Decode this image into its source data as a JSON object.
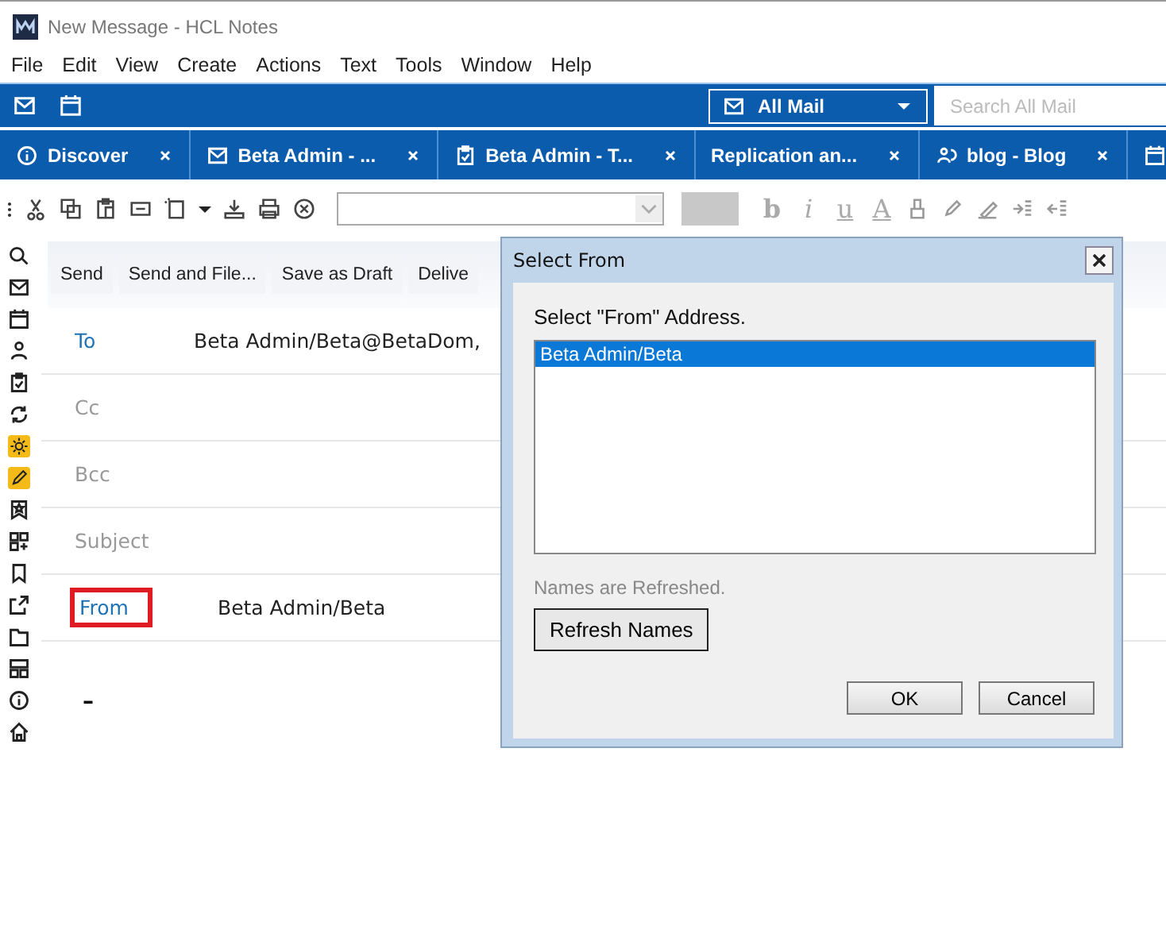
{
  "window": {
    "title": "New Message - HCL Notes"
  },
  "menu": [
    "File",
    "Edit",
    "View",
    "Create",
    "Actions",
    "Text",
    "Tools",
    "Window",
    "Help"
  ],
  "scope": {
    "label": "All Mail"
  },
  "search": {
    "placeholder": "Search All Mail"
  },
  "tabs": [
    {
      "label": "Discover"
    },
    {
      "label": "Beta Admin - ..."
    },
    {
      "label": "Beta Admin - T..."
    },
    {
      "label": "Replication an..."
    },
    {
      "label": "blog - Blog"
    }
  ],
  "format_buttons": [
    {
      "label": "b",
      "disabled": true
    },
    {
      "label": "i",
      "disabled": true
    },
    {
      "label": "u",
      "disabled": true
    },
    {
      "label": "A",
      "disabled": true
    }
  ],
  "actions": [
    "Send",
    "Send and File...",
    "Save as Draft",
    "Delive"
  ],
  "fields": [
    {
      "label": "To",
      "value": "Beta Admin/Beta@BetaDom,",
      "enabled": true,
      "highlighted": false
    },
    {
      "label": "Cc",
      "enabled": false,
      "highlighted": false
    },
    {
      "label": "Bcc",
      "enabled": false,
      "highlighted": false
    },
    {
      "label": "Subject",
      "enabled": false,
      "highlighted": false
    },
    {
      "label": "From",
      "value": "Beta Admin/Beta",
      "enabled": true,
      "highlighted": true
    }
  ],
  "body_text": "–",
  "dialog": {
    "title": "Select From",
    "prompt": "Select \"From\" Address.",
    "items": [
      {
        "text": "Beta Admin/Beta",
        "selected": true
      }
    ],
    "status": "Names are Refreshed.",
    "refresh_button": "Refresh Names",
    "ok_button": "OK",
    "cancel_button": "Cancel"
  }
}
